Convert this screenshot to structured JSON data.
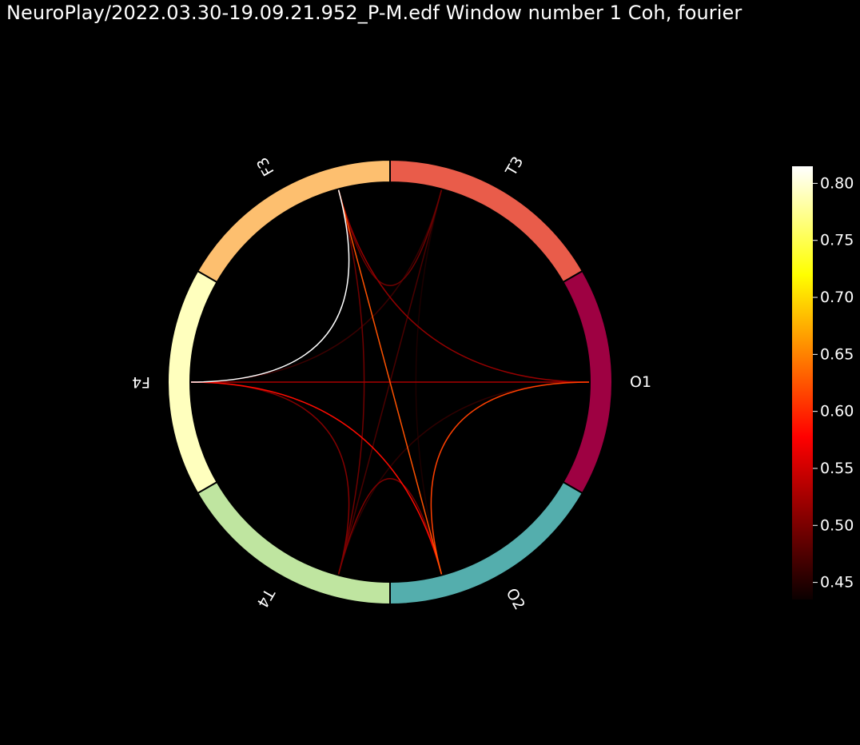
{
  "title": "NeuroPlay/2022.03.30-19.09.21.952_P-M.edf Window number 1  Coh, fourier",
  "chart_data": {
    "type": "connectivity-circle",
    "nodes": [
      {
        "name": "T3",
        "color": "#e95c4a"
      },
      {
        "name": "O1",
        "color": "#9e0142"
      },
      {
        "name": "O2",
        "color": "#54aead"
      },
      {
        "name": "T4",
        "color": "#bfe5a0"
      },
      {
        "name": "F4",
        "color": "#ffffbe"
      },
      {
        "name": "F3",
        "color": "#fdbf6f"
      }
    ],
    "connections": [
      {
        "source": "F3",
        "target": "F4",
        "value": 0.815
      },
      {
        "source": "F3",
        "target": "O2",
        "value": 0.62
      },
      {
        "source": "O1",
        "target": "O2",
        "value": 0.61
      },
      {
        "source": "F4",
        "target": "O2",
        "value": 0.58
      },
      {
        "source": "F4",
        "target": "O1",
        "value": 0.52
      },
      {
        "source": "F3",
        "target": "O1",
        "value": 0.51
      },
      {
        "source": "O2",
        "target": "T4",
        "value": 0.5
      },
      {
        "source": "F4",
        "target": "T4",
        "value": 0.5
      },
      {
        "source": "F3",
        "target": "T4",
        "value": 0.49
      },
      {
        "source": "F3",
        "target": "T3",
        "value": 0.49
      },
      {
        "source": "T3",
        "target": "T4",
        "value": 0.47
      },
      {
        "source": "F4",
        "target": "T3",
        "value": 0.46
      },
      {
        "source": "O1",
        "target": "T4",
        "value": 0.455
      },
      {
        "source": "T3",
        "target": "O2",
        "value": 0.445
      }
    ],
    "colormap": "hot",
    "vmin": 0.435,
    "vmax": 0.815,
    "colorbar_ticks": [
      "0.45",
      "0.50",
      "0.55",
      "0.60",
      "0.65",
      "0.70",
      "0.75",
      "0.80"
    ]
  }
}
